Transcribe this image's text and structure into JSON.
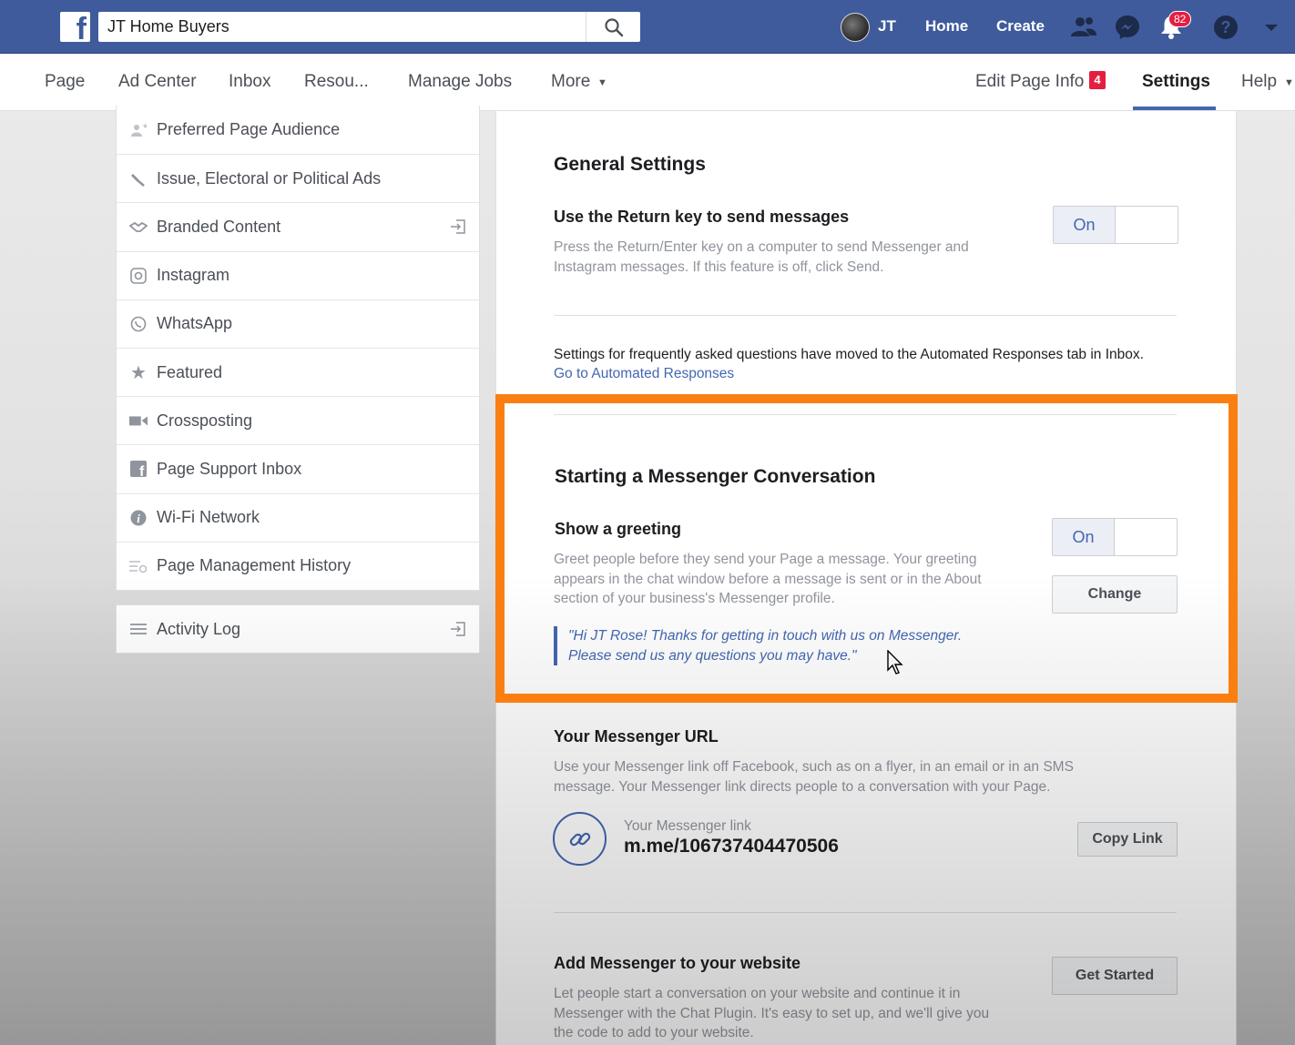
{
  "topbar": {
    "search_value": "JT Home Buyers",
    "user_name": "JT",
    "home_label": "Home",
    "create_label": "Create",
    "notification_count": "82",
    "brand_color": "#3f5b9c"
  },
  "pagenav": {
    "items": [
      "Page",
      "Ad Center",
      "Inbox",
      "Resou...",
      "Manage Jobs",
      "More"
    ],
    "edit_page_info": "Edit Page Info",
    "edit_badge": "4",
    "settings": "Settings",
    "help": "Help"
  },
  "sidebar": {
    "items": [
      {
        "label": "Preferred Page Audience",
        "icon": "audience-icon"
      },
      {
        "label": "Issue, Electoral or Political Ads",
        "icon": "megaphone-icon"
      },
      {
        "label": "Branded Content",
        "icon": "handshake-icon"
      },
      {
        "label": "Instagram",
        "icon": "instagram-icon"
      },
      {
        "label": "WhatsApp",
        "icon": "whatsapp-icon"
      },
      {
        "label": "Featured",
        "icon": "star-icon"
      },
      {
        "label": "Crossposting",
        "icon": "video-camera-icon"
      },
      {
        "label": "Page Support Inbox",
        "icon": "facebook-square-icon"
      },
      {
        "label": "Wi-Fi Network",
        "icon": "info-icon"
      },
      {
        "label": "Page Management History",
        "icon": "history-icon"
      }
    ],
    "activity_log": "Activity Log"
  },
  "general": {
    "title": "General Settings",
    "return_key_title": "Use the Return key to send messages",
    "return_key_desc_1": "Press the Return/Enter key on a computer to send Messenger and",
    "return_key_desc_2": "Instagram messages. If this feature is off, click Send.",
    "toggle_on": "On",
    "faq_note": "Settings for frequently asked questions have moved to the Automated Responses tab in Inbox.",
    "faq_link": "Go to Automated Responses"
  },
  "conversation": {
    "title": "Starting a Messenger Conversation",
    "greeting_title": "Show a greeting",
    "greeting_desc_1": "Greet people before they send your Page a message. Your greeting",
    "greeting_desc_2": "appears in the chat window before a message is sent or in the About",
    "greeting_desc_3": "section of your business's Messenger profile.",
    "toggle_on": "On",
    "change_label": "Change",
    "quote_1": "\"Hi JT Rose! Thanks for getting in touch with us on Messenger.",
    "quote_2": "Please send us any questions you may have.\"",
    "highlight_color": "#fb7f10"
  },
  "messenger_url": {
    "title": "Your Messenger URL",
    "desc_1": "Use your Messenger link off Facebook, such as on a flyer, in an email or in an SMS",
    "desc_2": "message. Your Messenger link directs people to a conversation with your Page.",
    "link_caption": "Your Messenger link",
    "link_value": "m.me/106737404470506",
    "copy_label": "Copy Link"
  },
  "website": {
    "title": "Add Messenger to your website",
    "desc_1": "Let people start a conversation on your website and continue it in",
    "desc_2": "Messenger with the Chat Plugin. It's easy to set up, and we'll give you",
    "desc_3": "the code to add to your website.",
    "get_started_label": "Get Started"
  }
}
